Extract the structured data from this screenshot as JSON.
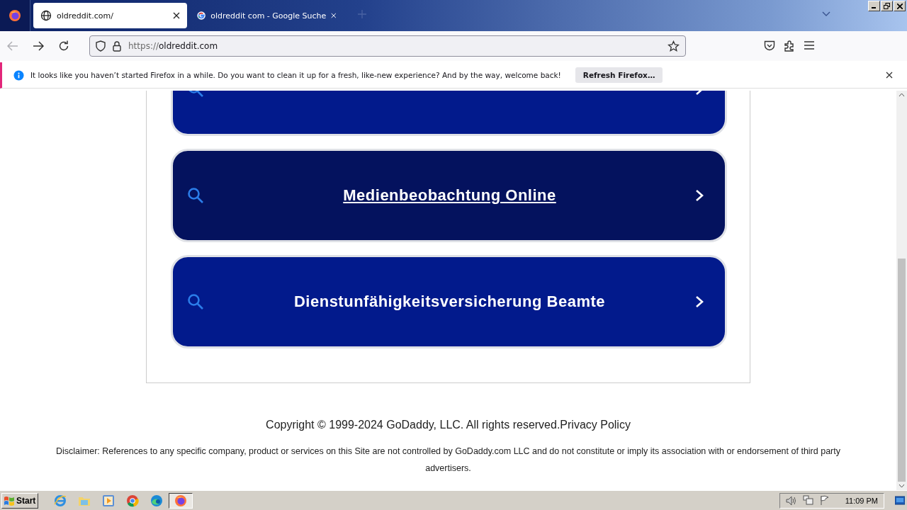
{
  "tabs": [
    {
      "title": "oldreddit.com/",
      "kind": "globe",
      "selected": true
    },
    {
      "title": "oldreddit com - Google Suche",
      "kind": "google",
      "selected": false
    }
  ],
  "address_bar": {
    "scheme": "https://",
    "host": "oldreddit.com"
  },
  "notification": {
    "message": "It looks like you haven’t started Firefox in a while. Do you want to clean it up for a fresh, like-new experience? And by the way, welcome back!",
    "button": "Refresh Firefox…"
  },
  "search_links": [
    {
      "hovered": false
    },
    {
      "label": "Medienbeobachtung Online",
      "hovered": true
    },
    {
      "label": "Dienstunfähigkeitsversicherung Beamte",
      "hovered": false
    }
  ],
  "footer": {
    "copyright": "Copyright © 1999-2024 GoDaddy, LLC. All rights reserved.",
    "privacy_link": "Privacy Policy",
    "disclaimer": "Disclaimer: References to any specific company, product or services on this Site are not controlled by GoDaddy.com LLC and do not constitute or imply its association with or endorsement of third party advertisers."
  },
  "taskbar": {
    "start": "Start",
    "apps": [
      {
        "kind": "ie",
        "selected": false
      },
      {
        "kind": "explorer",
        "selected": false
      },
      {
        "kind": "media",
        "selected": false
      },
      {
        "kind": "chrome",
        "selected": false
      },
      {
        "kind": "edge",
        "selected": false
      },
      {
        "kind": "firefox",
        "selected": true
      }
    ],
    "clock": "11:09 PM"
  }
}
